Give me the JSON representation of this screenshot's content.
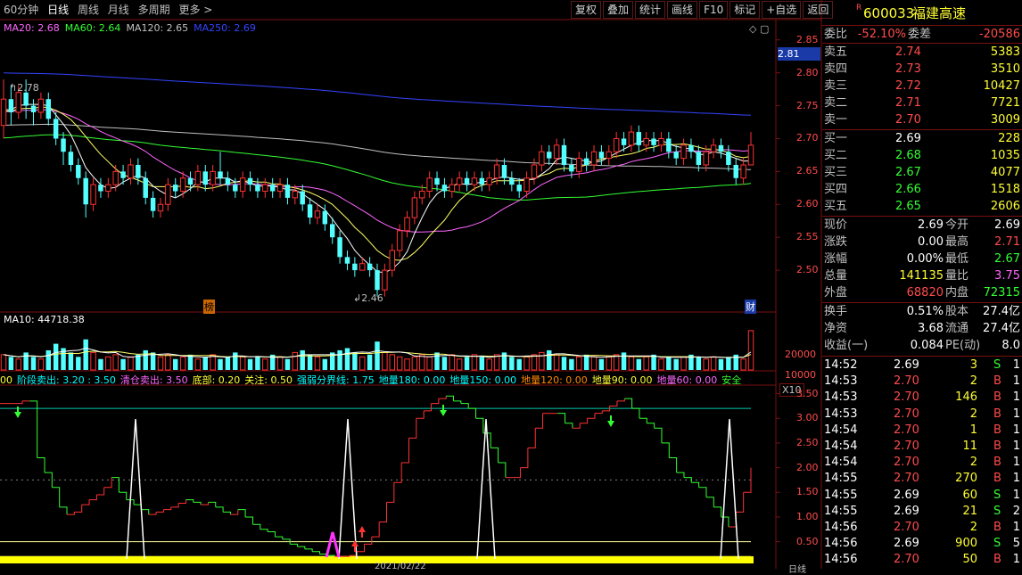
{
  "toolbar": {
    "left": [
      "60分钟",
      "日线",
      "周线",
      "月线",
      "多周期",
      "更多 >"
    ],
    "active": "日线",
    "right": [
      "复权",
      "叠加",
      "统计",
      "画线",
      "F10",
      "标记",
      "+自选",
      "返回"
    ]
  },
  "stock": {
    "code": "600033",
    "name": "福建高速",
    "badge": "R"
  },
  "main_legend": [
    {
      "text": "MA20: 2.68",
      "color": "#ff66ff"
    },
    {
      "text": "MA60: 2.64",
      "color": "#33ff33"
    },
    {
      "text": "MA120: 2.65",
      "color": "#c0c0c0"
    },
    {
      "text": "MA250: 2.69",
      "color": "#3344ff"
    }
  ],
  "main_yaxis": [
    "2.85",
    "2.80",
    "2.75",
    "2.70",
    "2.65",
    "2.60",
    "2.55",
    "2.50"
  ],
  "price_tag": "2.81",
  "annotations": {
    "high": "2.78",
    "low": "2.46",
    "bang": "榜",
    "cai": "财"
  },
  "volume": {
    "legend": "MA10: 44718.38",
    "yaxis": [
      "20000",
      "10000"
    ],
    "unit": "X10"
  },
  "indicator": {
    "legend": [
      {
        "text": "00",
        "color": "#ffff33"
      },
      {
        "text": "阶段卖出: 3.20 : 3.50",
        "color": "#00ffff"
      },
      {
        "text": "清仓卖出: 3.50",
        "color": "#ff66ff"
      },
      {
        "text": "底部: 0.20",
        "color": "#ffff33"
      },
      {
        "text": "关注: 0.50",
        "color": "#ffff33"
      },
      {
        "text": "强弱分界线: 1.75",
        "color": "#00ffff"
      },
      {
        "text": "地量180: 0.00",
        "color": "#00ffff"
      },
      {
        "text": "地量150: 0.00",
        "color": "#00ffff"
      },
      {
        "text": "地量120: 0.00",
        "color": "#ff8800"
      },
      {
        "text": "地量90: 0.00",
        "color": "#ffff33"
      },
      {
        "text": "地量60: 0.00",
        "color": "#ff66ff"
      },
      {
        "text": "安全",
        "color": "#33ff33"
      }
    ],
    "yaxis": [
      "3.50",
      "3.00",
      "2.50",
      "2.00",
      "1.50",
      "1.00",
      "0.50"
    ],
    "date_partial": "2021/02/22",
    "bottom_label": "日线"
  },
  "quote": {
    "weibi": {
      "label": "委比",
      "value": "-52.10%",
      "label2": "委差",
      "value2": "-20586"
    },
    "sells": [
      {
        "label": "卖五",
        "price": "2.74",
        "vol": "5383"
      },
      {
        "label": "卖四",
        "price": "2.73",
        "vol": "3510"
      },
      {
        "label": "卖三",
        "price": "2.72",
        "vol": "10427"
      },
      {
        "label": "卖二",
        "price": "2.71",
        "vol": "7721"
      },
      {
        "label": "卖一",
        "price": "2.70",
        "vol": "3009"
      }
    ],
    "buys": [
      {
        "label": "买一",
        "price": "2.69",
        "vol": "228"
      },
      {
        "label": "买二",
        "price": "2.68",
        "vol": "1035"
      },
      {
        "label": "买三",
        "price": "2.67",
        "vol": "4077"
      },
      {
        "label": "买四",
        "price": "2.66",
        "vol": "1518"
      },
      {
        "label": "买五",
        "price": "2.65",
        "vol": "2606"
      }
    ],
    "stats": [
      {
        "l1": "现价",
        "v1": "2.69",
        "c1": "white",
        "l2": "今开",
        "v2": "2.69",
        "c2": "white"
      },
      {
        "l1": "涨跌",
        "v1": "0.00",
        "c1": "white",
        "l2": "最高",
        "v2": "2.71",
        "c2": "red"
      },
      {
        "l1": "涨幅",
        "v1": "0.00%",
        "c1": "white",
        "l2": "最低",
        "v2": "2.67",
        "c2": "green"
      },
      {
        "l1": "总量",
        "v1": "141135",
        "c1": "yellow",
        "l2": "量比",
        "v2": "3.75",
        "c2": "purple"
      },
      {
        "l1": "外盘",
        "v1": "68820",
        "c1": "red",
        "l2": "内盘",
        "v2": "72315",
        "c2": "green"
      }
    ],
    "fin": [
      {
        "l1": "换手",
        "v1": "0.51%",
        "l2": "股本",
        "v2": "27.4亿"
      },
      {
        "l1": "净资",
        "v1": "3.68",
        "l2": "流通",
        "v2": "27.4亿"
      },
      {
        "l1": "收益(一)",
        "v1": "0.084",
        "l2": "PE(动)",
        "v2": "8.0"
      }
    ],
    "ticks": [
      {
        "t": "14:52",
        "p": "2.69",
        "pc": "white",
        "v": "3",
        "s": "S",
        "n": "1"
      },
      {
        "t": "14:53",
        "p": "2.70",
        "pc": "red",
        "v": "2",
        "s": "B",
        "n": "1"
      },
      {
        "t": "14:53",
        "p": "2.70",
        "pc": "red",
        "v": "146",
        "s": "B",
        "n": "1"
      },
      {
        "t": "14:53",
        "p": "2.70",
        "pc": "red",
        "v": "2",
        "s": "B",
        "n": "1"
      },
      {
        "t": "14:54",
        "p": "2.70",
        "pc": "red",
        "v": "1",
        "s": "B",
        "n": "1"
      },
      {
        "t": "14:54",
        "p": "2.70",
        "pc": "red",
        "v": "11",
        "s": "B",
        "n": "1"
      },
      {
        "t": "14:54",
        "p": "2.70",
        "pc": "red",
        "v": "2",
        "s": "B",
        "n": "1"
      },
      {
        "t": "14:55",
        "p": "2.70",
        "pc": "red",
        "v": "270",
        "s": "B",
        "n": "1"
      },
      {
        "t": "14:55",
        "p": "2.69",
        "pc": "white",
        "v": "60",
        "s": "S",
        "n": "1"
      },
      {
        "t": "14:55",
        "p": "2.69",
        "pc": "white",
        "v": "21",
        "s": "S",
        "n": "2"
      },
      {
        "t": "14:56",
        "p": "2.70",
        "pc": "red",
        "v": "2",
        "s": "B",
        "n": "1"
      },
      {
        "t": "14:56",
        "p": "2.69",
        "pc": "white",
        "v": "900",
        "s": "S",
        "n": "5"
      },
      {
        "t": "14:56",
        "p": "2.70",
        "pc": "red",
        "v": "50",
        "s": "B",
        "n": "1"
      }
    ]
  },
  "colors": {
    "up": "#ff3232",
    "down": "#54ffff",
    "grid": "#7a1010",
    "ma20": "#ff66ff",
    "ma60": "#33ff33",
    "ma120": "#c0c0c0",
    "ma250": "#3344ff",
    "ma5": "#ffffff",
    "ma10": "#ffff66"
  },
  "chart_data": {
    "type": "candlestick",
    "ylim": [
      2.45,
      2.87
    ],
    "candles": [
      [
        2.72,
        2.76,
        2.79,
        2.7
      ],
      [
        2.76,
        2.74,
        2.78,
        2.72
      ],
      [
        2.74,
        2.77,
        2.78,
        2.73
      ],
      [
        2.77,
        2.75,
        2.79,
        2.73
      ],
      [
        2.75,
        2.74,
        2.76,
        2.72
      ],
      [
        2.74,
        2.76,
        2.77,
        2.73
      ],
      [
        2.76,
        2.73,
        2.77,
        2.72
      ],
      [
        2.73,
        2.7,
        2.74,
        2.69
      ],
      [
        2.7,
        2.68,
        2.71,
        2.66
      ],
      [
        2.68,
        2.66,
        2.69,
        2.65
      ],
      [
        2.66,
        2.64,
        2.67,
        2.63
      ],
      [
        2.64,
        2.6,
        2.65,
        2.58
      ],
      [
        2.6,
        2.63,
        2.64,
        2.59
      ],
      [
        2.63,
        2.62,
        2.64,
        2.61
      ],
      [
        2.62,
        2.63,
        2.64,
        2.61
      ],
      [
        2.63,
        2.65,
        2.66,
        2.62
      ],
      [
        2.65,
        2.64,
        2.66,
        2.63
      ],
      [
        2.64,
        2.66,
        2.67,
        2.63
      ],
      [
        2.66,
        2.64,
        2.67,
        2.63
      ],
      [
        2.64,
        2.61,
        2.65,
        2.6
      ],
      [
        2.61,
        2.59,
        2.62,
        2.58
      ],
      [
        2.59,
        2.6,
        2.61,
        2.58
      ],
      [
        2.6,
        2.63,
        2.64,
        2.59
      ],
      [
        2.63,
        2.62,
        2.64,
        2.61
      ],
      [
        2.62,
        2.64,
        2.65,
        2.61
      ],
      [
        2.64,
        2.63,
        2.65,
        2.62
      ],
      [
        2.63,
        2.65,
        2.66,
        2.62
      ],
      [
        2.65,
        2.63,
        2.66,
        2.62
      ],
      [
        2.63,
        2.65,
        2.66,
        2.62
      ],
      [
        2.65,
        2.64,
        2.68,
        2.63
      ],
      [
        2.64,
        2.63,
        2.65,
        2.62
      ],
      [
        2.63,
        2.62,
        2.64,
        2.61
      ],
      [
        2.62,
        2.64,
        2.65,
        2.61
      ],
      [
        2.64,
        2.63,
        2.65,
        2.62
      ],
      [
        2.63,
        2.62,
        2.64,
        2.61
      ],
      [
        2.62,
        2.63,
        2.64,
        2.61
      ],
      [
        2.63,
        2.62,
        2.64,
        2.61
      ],
      [
        2.62,
        2.63,
        2.64,
        2.61
      ],
      [
        2.63,
        2.61,
        2.64,
        2.6
      ],
      [
        2.61,
        2.62,
        2.63,
        2.6
      ],
      [
        2.62,
        2.6,
        2.63,
        2.59
      ],
      [
        2.6,
        2.58,
        2.61,
        2.57
      ],
      [
        2.58,
        2.59,
        2.6,
        2.57
      ],
      [
        2.59,
        2.57,
        2.6,
        2.56
      ],
      [
        2.57,
        2.55,
        2.58,
        2.54
      ],
      [
        2.55,
        2.52,
        2.56,
        2.51
      ],
      [
        2.52,
        2.51,
        2.53,
        2.5
      ],
      [
        2.51,
        2.5,
        2.52,
        2.49
      ],
      [
        2.5,
        2.51,
        2.52,
        2.5
      ],
      [
        2.51,
        2.5,
        2.52,
        2.49
      ],
      [
        2.5,
        2.47,
        2.51,
        2.46
      ],
      [
        2.47,
        2.5,
        2.51,
        2.46
      ],
      [
        2.5,
        2.53,
        2.54,
        2.49
      ],
      [
        2.53,
        2.56,
        2.57,
        2.52
      ],
      [
        2.56,
        2.58,
        2.59,
        2.55
      ],
      [
        2.58,
        2.61,
        2.62,
        2.57
      ],
      [
        2.61,
        2.62,
        2.63,
        2.6
      ],
      [
        2.62,
        2.64,
        2.65,
        2.61
      ],
      [
        2.64,
        2.63,
        2.65,
        2.62
      ],
      [
        2.63,
        2.62,
        2.64,
        2.61
      ],
      [
        2.62,
        2.63,
        2.64,
        2.61
      ],
      [
        2.63,
        2.64,
        2.65,
        2.62
      ],
      [
        2.64,
        2.63,
        2.65,
        2.62
      ],
      [
        2.63,
        2.64,
        2.65,
        2.62
      ],
      [
        2.64,
        2.63,
        2.65,
        2.62
      ],
      [
        2.63,
        2.64,
        2.65,
        2.62
      ],
      [
        2.64,
        2.66,
        2.67,
        2.63
      ],
      [
        2.66,
        2.64,
        2.67,
        2.63
      ],
      [
        2.64,
        2.63,
        2.65,
        2.62
      ],
      [
        2.63,
        2.62,
        2.64,
        2.61
      ],
      [
        2.62,
        2.64,
        2.65,
        2.61
      ],
      [
        2.64,
        2.66,
        2.67,
        2.63
      ],
      [
        2.66,
        2.68,
        2.69,
        2.65
      ],
      [
        2.68,
        2.67,
        2.69,
        2.66
      ],
      [
        2.67,
        2.69,
        2.7,
        2.66
      ],
      [
        2.69,
        2.66,
        2.7,
        2.65
      ],
      [
        2.66,
        2.65,
        2.67,
        2.64
      ],
      [
        2.65,
        2.67,
        2.68,
        2.64
      ],
      [
        2.67,
        2.66,
        2.68,
        2.65
      ],
      [
        2.66,
        2.68,
        2.69,
        2.65
      ],
      [
        2.68,
        2.67,
        2.69,
        2.66
      ],
      [
        2.67,
        2.68,
        2.69,
        2.66
      ],
      [
        2.68,
        2.7,
        2.71,
        2.67
      ],
      [
        2.7,
        2.69,
        2.71,
        2.68
      ],
      [
        2.69,
        2.71,
        2.72,
        2.68
      ],
      [
        2.71,
        2.69,
        2.72,
        2.68
      ],
      [
        2.69,
        2.7,
        2.71,
        2.68
      ],
      [
        2.7,
        2.69,
        2.71,
        2.68
      ],
      [
        2.69,
        2.7,
        2.71,
        2.68
      ],
      [
        2.7,
        2.68,
        2.71,
        2.67
      ],
      [
        2.68,
        2.67,
        2.69,
        2.66
      ],
      [
        2.67,
        2.69,
        2.7,
        2.66
      ],
      [
        2.69,
        2.68,
        2.7,
        2.67
      ],
      [
        2.68,
        2.66,
        2.69,
        2.65
      ],
      [
        2.66,
        2.68,
        2.69,
        2.65
      ],
      [
        2.68,
        2.69,
        2.7,
        2.67
      ],
      [
        2.69,
        2.68,
        2.7,
        2.67
      ],
      [
        2.68,
        2.66,
        2.69,
        2.65
      ],
      [
        2.66,
        2.64,
        2.67,
        2.63
      ],
      [
        2.64,
        2.66,
        2.67,
        2.63
      ],
      [
        2.66,
        2.69,
        2.71,
        2.66
      ]
    ],
    "volumes": [
      7,
      6,
      5,
      8,
      6,
      5,
      9,
      12,
      10,
      8,
      6,
      14,
      8,
      5,
      6,
      7,
      5,
      6,
      7,
      9,
      8,
      6,
      7,
      5,
      6,
      7,
      5,
      6,
      7,
      5,
      6,
      8,
      6,
      5,
      6,
      5,
      7,
      6,
      5,
      8,
      9,
      7,
      6,
      5,
      8,
      9,
      10,
      8,
      6,
      7,
      13,
      8,
      7,
      6,
      5,
      6,
      7,
      6,
      8,
      6,
      7,
      5,
      6,
      7,
      6,
      5,
      7,
      8,
      6,
      5,
      6,
      7,
      8,
      9,
      7,
      6,
      5,
      6,
      7,
      6,
      5,
      6,
      7,
      8,
      6,
      5,
      6,
      7,
      5,
      6,
      5,
      6,
      7,
      6,
      5,
      6,
      5,
      6,
      7,
      5,
      18
    ]
  }
}
